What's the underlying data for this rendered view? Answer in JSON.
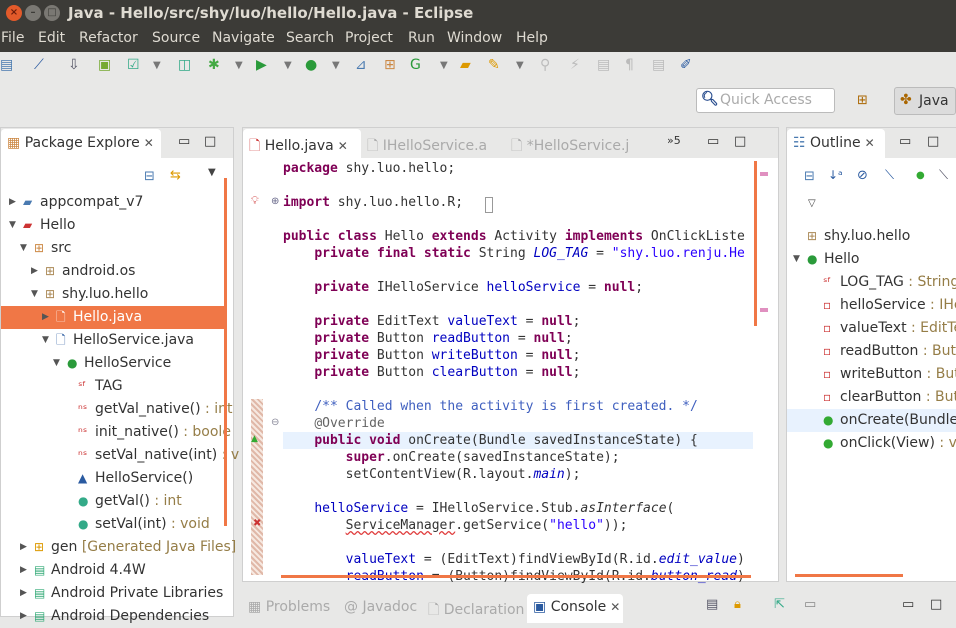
{
  "window": {
    "title": "Java - Hello/src/shy/luo/hello/Hello.java - Eclipse",
    "close": "×",
    "minimize": "–",
    "maximize": "□"
  },
  "menu": [
    "File",
    "Edit",
    "Refactor",
    "Source",
    "Navigate",
    "Search",
    "Project",
    "Run",
    "Window",
    "Help"
  ],
  "toolbar": {
    "icons": [
      "print-icon",
      "skip-breakpoints-icon",
      "android-sdk-manager-icon",
      "android-avd-manager-icon",
      "lint-check-icon",
      "new-android-project-icon",
      "debug-icon",
      "run-icon",
      "external-tools-icon",
      "new-java-project-icon",
      "new-package-icon",
      "new-class-icon",
      "open-type-icon",
      "search-icon",
      "toggle-mark-occurrences-icon",
      "toggle-breadcrumb-icon",
      "show-whitespace-icon",
      "block-selection-icon",
      "open-task-icon"
    ]
  },
  "quick_access": {
    "placeholder": "Quick Access"
  },
  "perspective": {
    "label": "Java"
  },
  "package_explorer": {
    "title": "Package Explore",
    "items": [
      {
        "label": "appcompat_v7",
        "level": 0,
        "expanded": false,
        "icon": "project-icon"
      },
      {
        "label": "Hello",
        "level": 0,
        "expanded": true,
        "icon": "project-error-icon"
      },
      {
        "label": "src",
        "level": 1,
        "expanded": true,
        "icon": "source-folder-icon"
      },
      {
        "label": "android.os",
        "level": 2,
        "expanded": false,
        "icon": "package-icon"
      },
      {
        "label": "shy.luo.hello",
        "level": 2,
        "expanded": true,
        "icon": "package-icon"
      },
      {
        "label": "Hello.java",
        "level": 3,
        "expanded": false,
        "icon": "java-file-icon",
        "selected": true
      },
      {
        "label": "HelloService.java",
        "level": 3,
        "expanded": true,
        "icon": "java-file-icon"
      },
      {
        "label": "HelloService",
        "level": 4,
        "expanded": true,
        "icon": "class-icon"
      },
      {
        "label": "TAG",
        "level": 5,
        "icon": "static-final-field-icon"
      },
      {
        "label": "getVal_native()",
        "type": " : int",
        "level": 5,
        "icon": "native-method-icon"
      },
      {
        "label": "init_native()",
        "type": " : boole",
        "level": 5,
        "icon": "native-method-icon"
      },
      {
        "label": "setVal_native(int)",
        "type": " : v",
        "level": 5,
        "icon": "native-method-icon"
      },
      {
        "label": "HelloService()",
        "level": 5,
        "icon": "constructor-icon"
      },
      {
        "label": "getVal()",
        "type": " : int",
        "level": 5,
        "icon": "method-icon"
      },
      {
        "label": "setVal(int)",
        "type": " : void",
        "level": 5,
        "icon": "method-icon"
      },
      {
        "label": "gen",
        "type": " [Generated Java Files]",
        "level": 1,
        "expanded": false,
        "icon": "gen-folder-icon"
      },
      {
        "label": "Android 4.4W",
        "level": 1,
        "expanded": false,
        "icon": "library-icon"
      },
      {
        "label": "Android Private Libraries",
        "level": 1,
        "expanded": false,
        "icon": "library-icon"
      },
      {
        "label": "Android Dependencies",
        "level": 1,
        "expanded": false,
        "icon": "library-icon"
      }
    ]
  },
  "editor": {
    "tabs": [
      {
        "label": "Hello.java",
        "active": true
      },
      {
        "label": "IHelloService.a",
        "active": false
      },
      {
        "label": "*HelloService.j",
        "active": false
      }
    ],
    "overflow": "»5",
    "lines": [
      {
        "n": 0,
        "seg": [
          [
            "package",
            "k"
          ],
          [
            " shy.luo.hello;",
            ""
          ]
        ]
      },
      {
        "n": 2,
        "seg": [
          [
            "import",
            "k"
          ],
          [
            " shy.luo.hello.R;",
            ""
          ]
        ]
      },
      {
        "n": 4,
        "seg": [
          [
            "public",
            "k"
          ],
          [
            " ",
            ""
          ],
          [
            "class",
            "k"
          ],
          [
            " Hello ",
            ""
          ],
          [
            "extends",
            "k"
          ],
          [
            " Activity ",
            ""
          ],
          [
            "implements",
            "k"
          ],
          [
            " OnClickListe",
            ""
          ]
        ]
      },
      {
        "n": 5,
        "seg": [
          [
            "    ",
            ""
          ],
          [
            "private",
            "k"
          ],
          [
            " ",
            ""
          ],
          [
            "final",
            "k"
          ],
          [
            " ",
            ""
          ],
          [
            "static",
            "k"
          ],
          [
            " String ",
            ""
          ],
          [
            "LOG_TAG",
            "fi"
          ],
          [
            " = ",
            ""
          ],
          [
            "\"shy.luo.renju.He",
            "s"
          ]
        ]
      },
      {
        "n": 7,
        "seg": [
          [
            "    ",
            ""
          ],
          [
            "private",
            "k"
          ],
          [
            " IHelloService ",
            ""
          ],
          [
            "helloService",
            "f"
          ],
          [
            " = ",
            ""
          ],
          [
            "null",
            "k"
          ],
          [
            ";",
            ""
          ]
        ]
      },
      {
        "n": 9,
        "seg": [
          [
            "    ",
            ""
          ],
          [
            "private",
            "k"
          ],
          [
            " EditText ",
            ""
          ],
          [
            "valueText",
            "f"
          ],
          [
            " = ",
            ""
          ],
          [
            "null",
            "k"
          ],
          [
            ";",
            ""
          ]
        ]
      },
      {
        "n": 10,
        "seg": [
          [
            "    ",
            ""
          ],
          [
            "private",
            "k"
          ],
          [
            " Button ",
            ""
          ],
          [
            "readButton",
            "f"
          ],
          [
            " = ",
            ""
          ],
          [
            "null",
            "k"
          ],
          [
            ";",
            ""
          ]
        ]
      },
      {
        "n": 11,
        "seg": [
          [
            "    ",
            ""
          ],
          [
            "private",
            "k"
          ],
          [
            " Button ",
            ""
          ],
          [
            "writeButton",
            "f"
          ],
          [
            " = ",
            ""
          ],
          [
            "null",
            "k"
          ],
          [
            ";",
            ""
          ]
        ]
      },
      {
        "n": 12,
        "seg": [
          [
            "    ",
            ""
          ],
          [
            "private",
            "k"
          ],
          [
            " Button ",
            ""
          ],
          [
            "clearButton",
            "f"
          ],
          [
            " = ",
            ""
          ],
          [
            "null",
            "k"
          ],
          [
            ";",
            ""
          ]
        ]
      },
      {
        "n": 14,
        "seg": [
          [
            "    ",
            ""
          ],
          [
            "/** Called when the activity is first created. */",
            "c"
          ]
        ]
      },
      {
        "n": 15,
        "seg": [
          [
            "    ",
            ""
          ],
          [
            "@Override",
            "a"
          ]
        ]
      },
      {
        "n": 16,
        "hl": true,
        "seg": [
          [
            "    ",
            ""
          ],
          [
            "public",
            "k"
          ],
          [
            " ",
            ""
          ],
          [
            "void",
            "k"
          ],
          [
            " onCreate(Bundle savedInstanceState) {",
            ""
          ]
        ]
      },
      {
        "n": 17,
        "seg": [
          [
            "        ",
            ""
          ],
          [
            "super",
            "k"
          ],
          [
            ".onCreate(savedInstanceState);",
            ""
          ]
        ]
      },
      {
        "n": 18,
        "seg": [
          [
            "        setContentView(R.layout.",
            ""
          ],
          [
            "main",
            "fi"
          ],
          [
            ");",
            ""
          ]
        ]
      },
      {
        "n": 20,
        "seg": [
          [
            "    ",
            ""
          ],
          [
            "helloService",
            "f"
          ],
          [
            " = IHelloService.Stub.",
            ""
          ],
          [
            "asInterface",
            "mi"
          ],
          [
            "(",
            ""
          ]
        ]
      },
      {
        "n": 21,
        "seg": [
          [
            "        ",
            ""
          ],
          [
            "ServiceManager",
            "err"
          ],
          [
            ".getService(",
            ""
          ],
          [
            "\"hello\"",
            "s"
          ],
          [
            "));",
            ""
          ]
        ]
      },
      {
        "n": 23,
        "seg": [
          [
            "        ",
            ""
          ],
          [
            "valueText",
            "f"
          ],
          [
            " = (EditText)findViewById(R.id.",
            ""
          ],
          [
            "edit_value",
            "fi"
          ],
          [
            ")",
            ""
          ]
        ]
      },
      {
        "n": 24,
        "seg": [
          [
            "        ",
            ""
          ],
          [
            "readButton",
            "f"
          ],
          [
            " = (Button)findViewById(R.id.",
            ""
          ],
          [
            "button_read",
            "fi"
          ],
          [
            ")",
            ""
          ]
        ]
      }
    ]
  },
  "outline": {
    "title": "Outline",
    "items": [
      {
        "label": "shy.luo.hello",
        "icon": "package-icon",
        "level": 0
      },
      {
        "label": "Hello",
        "icon": "class-error-icon",
        "level": 0,
        "expanded": true
      },
      {
        "label": "LOG_TAG",
        "type": " : String",
        "icon": "static-final-field-icon",
        "level": 1
      },
      {
        "label": "helloService",
        "type": " : IHe",
        "icon": "private-field-icon",
        "level": 1
      },
      {
        "label": "valueText",
        "type": " : EditTe",
        "icon": "private-field-icon",
        "level": 1
      },
      {
        "label": "readButton",
        "type": " : But",
        "icon": "private-field-icon",
        "level": 1
      },
      {
        "label": "writeButton",
        "type": " : But",
        "icon": "private-field-icon",
        "level": 1
      },
      {
        "label": "clearButton",
        "type": " : But",
        "icon": "private-field-icon",
        "level": 1
      },
      {
        "label": "onCreate(Bundle",
        "icon": "override-method-error-icon",
        "level": 1,
        "selected": true
      },
      {
        "label": "onClick(View)",
        "type": " : vo",
        "icon": "public-method-icon",
        "level": 1
      }
    ]
  },
  "bottom": {
    "tabs": [
      {
        "label": "Problems",
        "active": false
      },
      {
        "label": "Javadoc",
        "active": false
      },
      {
        "label": "Declaration",
        "active": false
      },
      {
        "label": "Console",
        "active": true
      }
    ]
  },
  "colors": {
    "accent": "#f07746",
    "keyword": "#7f0055",
    "field": "#0000c0",
    "string": "#2a00ff",
    "comment": "#3f5fbf",
    "titlebar": "#3c3b37"
  }
}
